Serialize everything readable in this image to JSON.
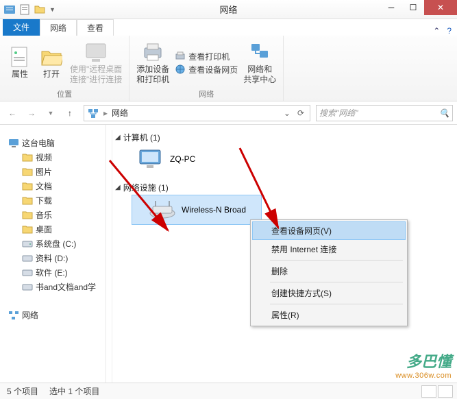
{
  "titlebar": {
    "title": "网络"
  },
  "tabs": {
    "file": "文件",
    "network": "网络",
    "view": "查看"
  },
  "ribbon": {
    "group_location": "位置",
    "group_network": "网络",
    "properties": "属性",
    "open": "打开",
    "rdp": "使用\"远程桌面\n连接\"进行连接",
    "add_devices": "添加设备\n和打印机",
    "view_printers": "查看打印机",
    "view_device_page": "查看设备网页",
    "net_share": "网络和\n共享中心"
  },
  "breadcrumb": {
    "location": "网络"
  },
  "search": {
    "placeholder": "搜索\"网络\""
  },
  "sidebar": {
    "this_pc": "这台电脑",
    "videos": "视频",
    "pictures": "图片",
    "documents": "文档",
    "downloads": "下载",
    "music": "音乐",
    "desktop": "桌面",
    "drive_c": "系统盘 (C:)",
    "drive_d": "资料 (D:)",
    "drive_e": "软件 (E:)",
    "drive_books": "书and文档and学",
    "network": "网络"
  },
  "main": {
    "group_computer": "计算机 (1)",
    "computer_name": "ZQ-PC",
    "group_netdev": "网络设施 (1)",
    "device_name": "Wireless-N Broad"
  },
  "context": {
    "view_page": "查看设备网页(V)",
    "disable_net": "禁用 Internet 连接",
    "delete": "删除",
    "shortcut": "创建快捷方式(S)",
    "properties": "属性(R)"
  },
  "status": {
    "count": "5 个项目",
    "selected": "选中 1 个项目"
  },
  "watermark": {
    "text": "多巴懂",
    "url": "www.306w.com"
  }
}
